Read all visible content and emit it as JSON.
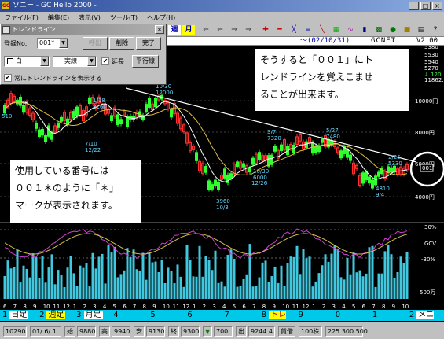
{
  "window": {
    "title": "ソニー - GC Hello 2000 -",
    "controls": [
      "_",
      "□",
      "×"
    ]
  },
  "menu": [
    "ファイル(F)",
    "編集(E)",
    "表示(V)",
    "ツール(T)",
    "ヘルプ(H)"
  ],
  "toolbar": {
    "buttons": [
      "週",
      "月",
      "⇐",
      "⇐",
      "⇒",
      "⇒"
    ]
  },
  "infobar": {
    "date": "～(02/10/31)",
    "source": "GCNET",
    "version": "V2.00"
  },
  "trend_dialog": {
    "title": "トレンドライン",
    "reg_label": "登録No.",
    "reg_value": "001*",
    "btn_call": "呼出",
    "btn_delete": "削除",
    "btn_done": "完了",
    "color_value": "白",
    "line_value": "実線",
    "extend_label": "延長",
    "extend_checked": "✔",
    "parallel_label": "平行線",
    "always_label": "常にトレンドラインを表示する",
    "always_checked": "✔"
  },
  "callouts": {
    "top": [
      "そうすると「００１」にト",
      "レンドラインを覚えこませ",
      "ることが出来ます。"
    ],
    "left": [
      "使用している番号には",
      "００１＊のように「＊」",
      "マークが表示されます。"
    ]
  },
  "price_axis": {
    "top": [
      "5380",
      "5530",
      "5540",
      "5270",
      "↓ 120",
      "11862.6"
    ],
    "levels": [
      "10000円",
      "8000円",
      "6000円",
      "4000円"
    ]
  },
  "annotations": [
    "1/18\n8160",
    "10/30\n12000",
    "7/10\n12/22",
    "3/7\n7320",
    "5/27\n7480",
    "10/30\n6000",
    "12/26",
    "3960\n10/3",
    "4810\n9/4",
    "2/25\n5330"
  ],
  "marker_value": "001",
  "indicator": {
    "labels": [
      "30%",
      "GCV",
      "-30%",
      "500万"
    ]
  },
  "month_ticks": [
    "6",
    "7",
    "8",
    "9",
    "10",
    "11",
    "12",
    "1",
    "2",
    "3",
    "4",
    "5",
    "6",
    "7",
    "8",
    "9",
    "10",
    "11",
    "12",
    "1",
    "2",
    "3",
    "4",
    "5",
    "6",
    "7",
    "8",
    "9",
    "10",
    "11",
    "12",
    "1",
    "2",
    "3",
    "4",
    "5",
    "6",
    "7",
    "8",
    "9",
    "10"
  ],
  "funcbar": [
    {
      "num": "1",
      "label": "日足"
    },
    {
      "num": "2",
      "label": "週足"
    },
    {
      "num": "3",
      "label": "月足"
    },
    {
      "num": "4",
      "label": ""
    },
    {
      "num": "5",
      "label": ""
    },
    {
      "num": "6",
      "label": ""
    },
    {
      "num": "7",
      "label": ""
    },
    {
      "num": "8",
      "label": "トレンド"
    },
    {
      "num": "9",
      "label": ""
    },
    {
      "num": "0",
      "label": ""
    },
    {
      "num": "1",
      "label": ""
    },
    {
      "num": "2",
      "label": "メニュー"
    }
  ],
  "status": [
    "10290",
    "01/ 6/ 1",
    "始",
    "9880",
    "高",
    "9940",
    "安",
    "9130",
    "終",
    "9300",
    "▼",
    "700",
    "出",
    "9244.4",
    "貸借",
    "100株",
    "225 300 500"
  ],
  "colors": {
    "candle_up": "#ff3030",
    "candle_down": "#30ff30",
    "ma_short": "#ffffff",
    "ma_long": "#e0c040",
    "volume": "#40c8e0",
    "osc": "#d040d0",
    "trendline": "#ffffff"
  }
}
